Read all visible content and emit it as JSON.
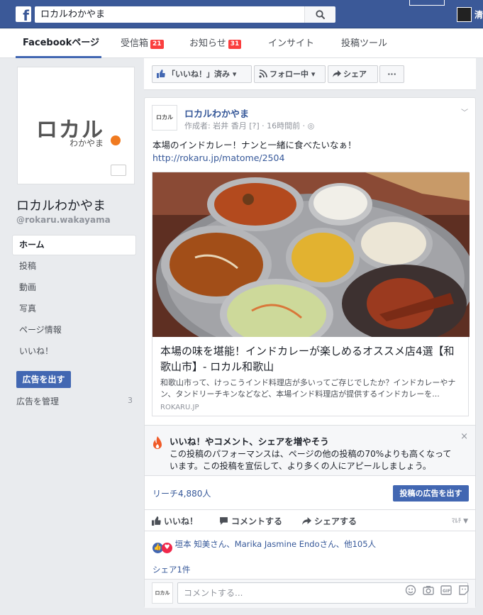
{
  "topbar": {
    "logo": "f",
    "search_value": "ロカルわかやま",
    "user_initial": "清"
  },
  "tabs": [
    {
      "label": "Facebookページ"
    },
    {
      "label": "受信箱",
      "badge": "21"
    },
    {
      "label": "お知らせ",
      "badge": "31"
    },
    {
      "label": "インサイト"
    },
    {
      "label": "投稿ツール"
    }
  ],
  "sidebar": {
    "logo_main": "ロカル",
    "logo_sub": "わかやま",
    "page_name": "ロカルわかやま",
    "handle": "@rokaru.wakayama",
    "nav": [
      "ホーム",
      "投稿",
      "動画",
      "写真",
      "ページ情報",
      "いいね！"
    ],
    "ad_button": "広告を出す",
    "manage_ads": "広告を管理",
    "manage_count": "3"
  },
  "actionbar": {
    "liked": "「いいね！」済み",
    "following": "フォロー中",
    "share": "シェア",
    "more": "···"
  },
  "post": {
    "avatar_text": "ロカル",
    "author": "ロカルわかやま",
    "meta": "作成者: 岩井 香月 [?] · 16時間前 · ◎",
    "text": "本場のインドカレー！ナンと一緒に食べたいなぁ！",
    "link": "http://rokaru.jp/matome/2504",
    "card_title": "本場の味を堪能！インドカレーが楽しめるオススメ店4選【和歌山市】- ロカル和歌山",
    "card_desc": "和歌山市って、けっこうインド料理店が多いってご存じでしたか？インドカレーやナン、タンドリーチキンなどなど、本場インド料理店が提供するインドカレーを...",
    "card_domain": "ROKARU.JP",
    "promo_title": "いいね！やコメント、シェアを増やそう",
    "promo_body": "この投稿のパフォーマンスは、ページの他の投稿の70%よりも高くなっています。この投稿を宣伝して、より多くの人にアピールしましょう。",
    "reach": "リーチ4,880人",
    "boost": "投稿の広告を出す",
    "act_like": "いいね！",
    "act_comment": "コメントする",
    "act_share": "シェアする",
    "reactors": "垣本 知美さん、Marika Jasmine Endoさん、他105人",
    "shares": "シェア1件",
    "comment_placeholder": "コメントする..."
  },
  "colors": {
    "brand": "#3b5998",
    "button": "#4267b2",
    "link": "#365899",
    "badge": "#fa3e3e"
  }
}
